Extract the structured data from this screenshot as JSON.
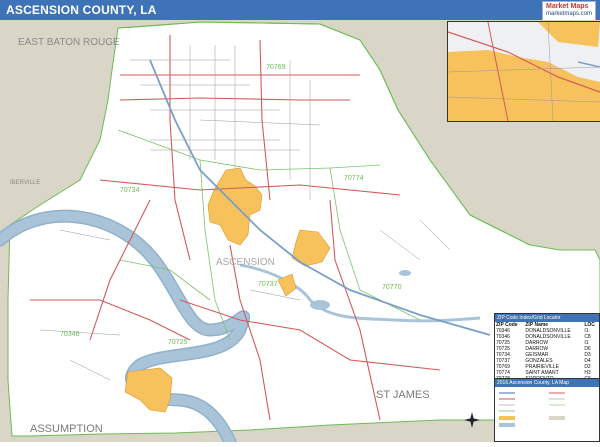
{
  "title": "ASCENSION COUNTY, LA",
  "logo": {
    "line1": "Market Maps",
    "line2": "marketmaps.com"
  },
  "map": {
    "labels": {
      "east_baton_rouge": "EAST BATON ROUGE",
      "iberville": "IBERVILLE",
      "ascension": "ASCENSION",
      "st_james": "ST JAMES",
      "assumption": "ASSUMPTION"
    },
    "zip_labels": [
      "70769",
      "70774",
      "70734",
      "70737",
      "70770",
      "70346",
      "70725"
    ],
    "colors": {
      "water": "#a9c4d8",
      "land_outside": "#d9d5c7",
      "county": "#ffffff",
      "city": "#f7c15c",
      "road_major": "#d25a5a",
      "road_minor": "#888888",
      "zip_boundary": "#7cc26a",
      "title_bar": "#3f73b7"
    }
  },
  "zip_table": {
    "title": "ZIP Code Index/Grid Locator",
    "headers": [
      "ZIP Code",
      "ZIP Name",
      "LOC"
    ],
    "rows": [
      [
        "70346",
        "DONALDSONVILLE",
        "I1"
      ],
      [
        "70346",
        "DONALDSONVILLE",
        "C8"
      ],
      [
        "70725",
        "DARROW",
        "I1"
      ],
      [
        "70725",
        "DARROW",
        "D6"
      ],
      [
        "70734",
        "GEISMAR",
        "D3"
      ],
      [
        "70737",
        "GONZALES",
        "D4"
      ],
      [
        "70769",
        "PRAIRIEVILLE",
        "D2"
      ],
      [
        "70774",
        "SAINT AMANT",
        "H3"
      ],
      [
        "70778",
        "SORRENTO",
        "G5"
      ]
    ]
  },
  "legend": {
    "title": "2016 Ascension County, LA Map"
  }
}
